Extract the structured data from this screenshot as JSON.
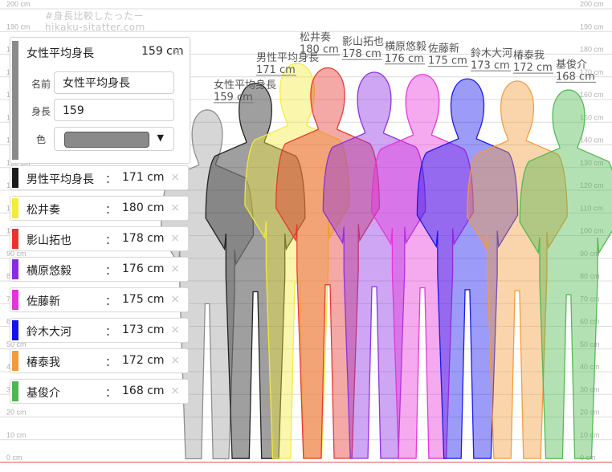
{
  "watermark": {
    "line1": "#身長比較したったー",
    "line2": "hikaku-sitatter.com"
  },
  "chart_data": {
    "type": "height-comparison",
    "unit": "cm",
    "scale_labels": [
      "0 cm",
      "10 cm",
      "20 cm",
      "30 cm",
      "40 cm",
      "50 cm",
      "60 cm",
      "70 cm",
      "80 cm",
      "90 cm",
      "100 cm",
      "110 cm",
      "120 cm",
      "130 cm",
      "140 cm",
      "150 cm",
      "160 cm",
      "170 cm",
      "180 cm",
      "190 cm",
      "200 cm"
    ],
    "ylim": [
      0,
      200
    ],
    "figures": [
      {
        "name": "女性平均身長",
        "height": 159,
        "label_name": "女性平均身長",
        "label_value": "159 cm",
        "color": "#8a8a8a"
      },
      {
        "name": "男性平均身長",
        "height": 171,
        "label_name": "男性平均身長",
        "label_value": "171 cm",
        "color": "#1a1a1a"
      },
      {
        "name": "松井奏",
        "height": 180,
        "label_name": "松井奏",
        "label_value": "180 cm",
        "color": "#f2ec3a"
      },
      {
        "name": "影山拓也",
        "height": 178,
        "label_name": "影山拓也",
        "label_value": "178 cm",
        "color": "#e8332a"
      },
      {
        "name": "横原悠毅",
        "height": 176,
        "label_name": "横原悠毅",
        "label_value": "176 cm",
        "color": "#8a2be2"
      },
      {
        "name": "佐藤新",
        "height": 175,
        "label_name": "佐藤新",
        "label_value": "175 cm",
        "color": "#e632d8"
      },
      {
        "name": "鈴木大河",
        "height": 173,
        "label_name": "鈴木大河",
        "label_value": "173 cm",
        "color": "#1212ee"
      },
      {
        "name": "椿泰我",
        "height": 172,
        "label_name": "椿泰我",
        "label_value": "172 cm",
        "color": "#f39a3a"
      },
      {
        "name": "基俊介",
        "height": 168,
        "label_name": "基俊介",
        "label_value": "168 cm",
        "color": "#4db84d"
      }
    ]
  },
  "editor": {
    "title": "女性平均身長",
    "title_value": "159 cm",
    "name_label": "名前",
    "name_value": "女性平均身長",
    "height_label": "身長",
    "height_value": "159",
    "color_label": "色",
    "color_value": "#8a8a8a",
    "caret": "▼",
    "close": "×"
  },
  "list": [
    {
      "name": "男性平均身長",
      "colon": "：",
      "value": "171 cm",
      "color": "#1a1a1a",
      "close": "×"
    },
    {
      "name": "松井奏",
      "colon": "：",
      "value": "180 cm",
      "color": "#f2ec3a",
      "close": "×"
    },
    {
      "name": "影山拓也",
      "colon": "：",
      "value": "178 cm",
      "color": "#e8332a",
      "close": "×"
    },
    {
      "name": "横原悠毅",
      "colon": "：",
      "value": "176 cm",
      "color": "#8a2be2",
      "close": "×"
    },
    {
      "name": "佐藤新",
      "colon": "：",
      "value": "175 cm",
      "color": "#e632d8",
      "close": "×"
    },
    {
      "name": "鈴木大河",
      "colon": "：",
      "value": "173 cm",
      "color": "#1212ee",
      "close": "×"
    },
    {
      "name": "椿泰我",
      "colon": "：",
      "value": "172 cm",
      "color": "#f39a3a",
      "close": "×"
    },
    {
      "name": "基俊介",
      "colon": "：",
      "value": "168 cm",
      "color": "#4db84d",
      "close": "×"
    }
  ]
}
